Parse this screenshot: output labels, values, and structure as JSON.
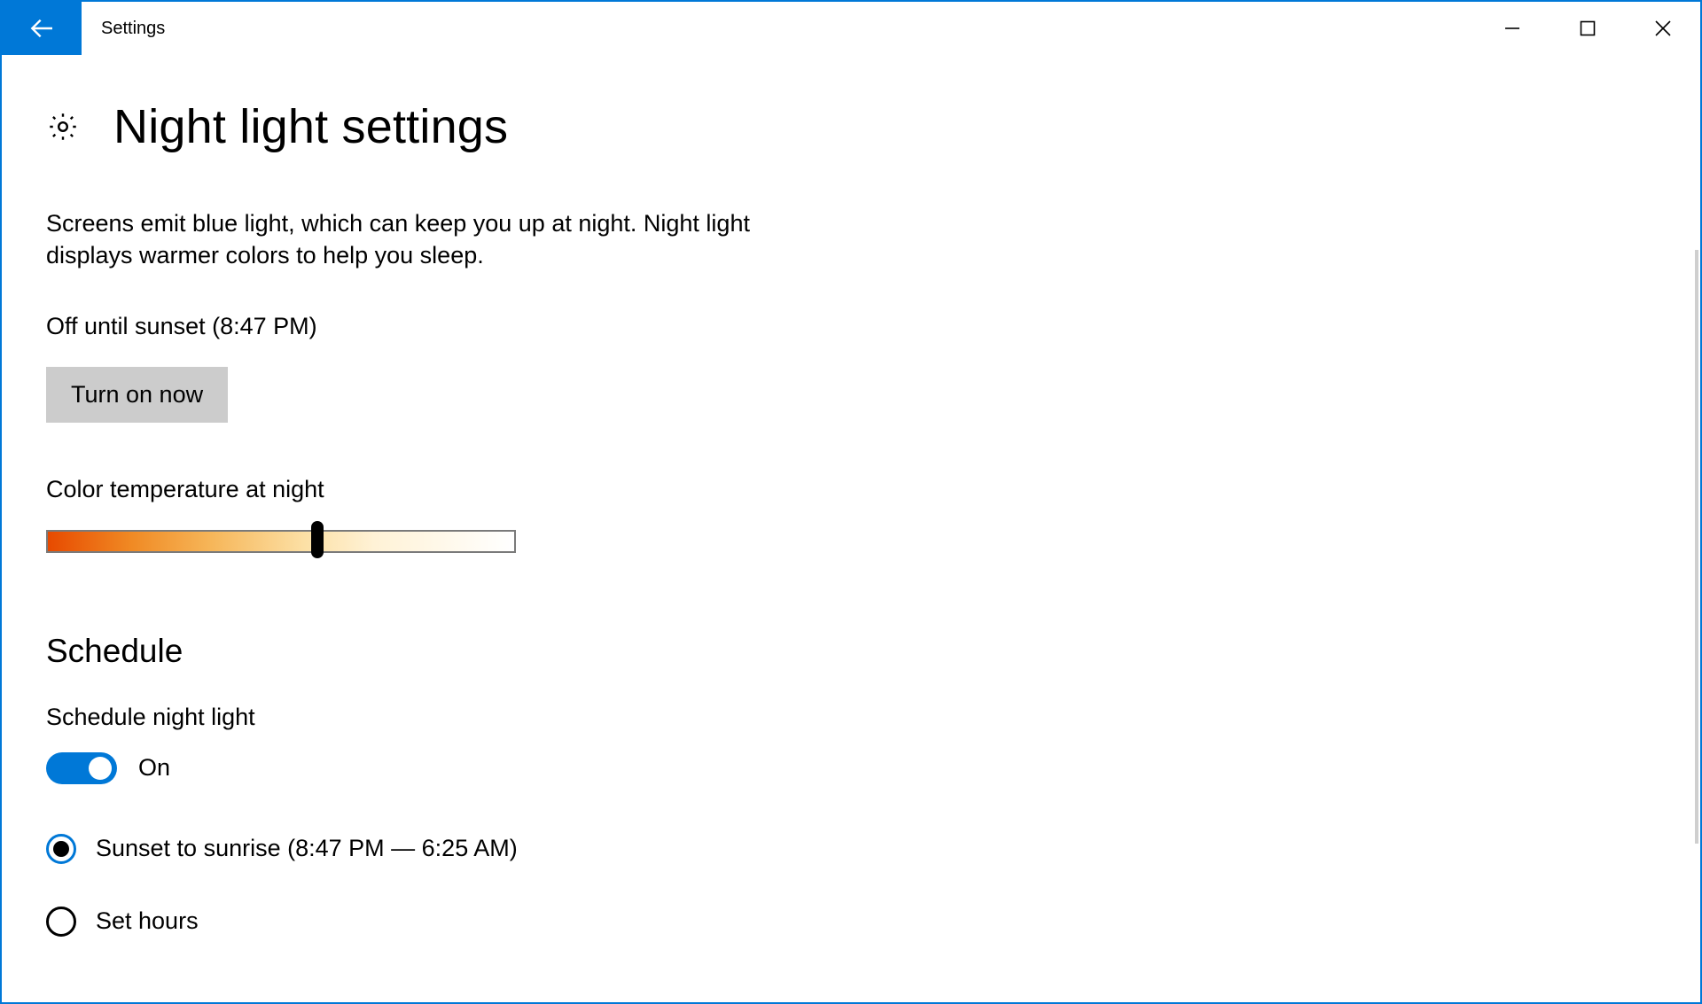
{
  "window": {
    "title": "Settings"
  },
  "page": {
    "heading": "Night light settings",
    "description": "Screens emit blue light, which can keep you up at night. Night light displays warmer colors to help you sleep.",
    "status": "Off until sunset (8:47 PM)",
    "action_button": "Turn on now"
  },
  "slider": {
    "label": "Color temperature at night",
    "value_pct": 58
  },
  "schedule": {
    "heading": "Schedule",
    "toggle_label": "Schedule night light",
    "toggle_state": "On",
    "options": [
      {
        "label": "Sunset to sunrise (8:47 PM — 6:25 AM)",
        "selected": true
      },
      {
        "label": "Set hours",
        "selected": false
      }
    ]
  }
}
